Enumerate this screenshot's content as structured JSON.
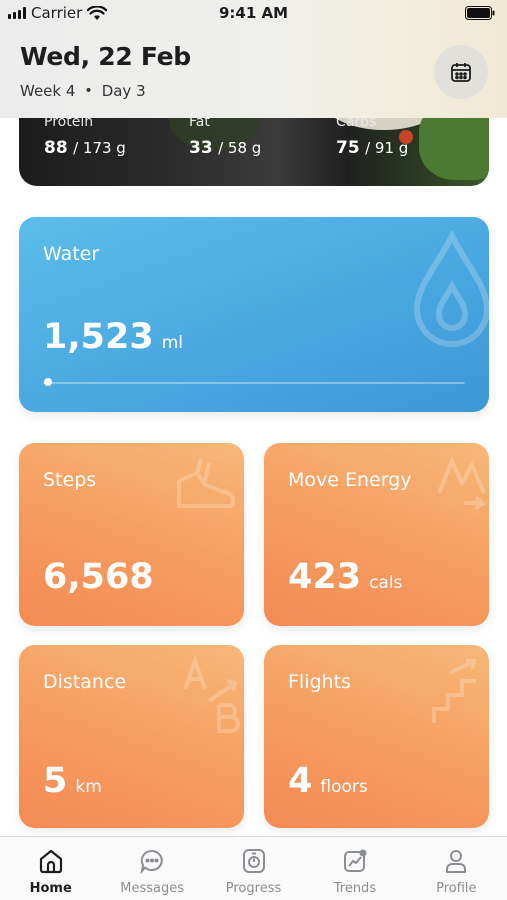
{
  "status_bar": {
    "carrier": "Carrier",
    "time": "9:41 AM"
  },
  "header": {
    "date": "Wed, 22 Feb",
    "week": "Week 4",
    "separator": "•",
    "day": "Day 3",
    "calendar_icon": "calendar-icon"
  },
  "nutrition": [
    {
      "label": "Protein",
      "value": "88",
      "goal": "/ 173 g"
    },
    {
      "label": "Fat",
      "value": "33",
      "goal": "/ 58 g"
    },
    {
      "label": "Carbs",
      "value": "75",
      "goal": "/ 91 g"
    }
  ],
  "water": {
    "title": "Water",
    "value": "1,523",
    "unit": "ml",
    "progress": 0.0,
    "icon": "water-drop-icon",
    "color": "#4aa8e0"
  },
  "steps": {
    "title": "Steps",
    "value": "6,568",
    "unit": "",
    "icon": "shoe-icon"
  },
  "move_energy": {
    "title": "Move Energy",
    "value": "423",
    "unit": "cals",
    "icon": "lightning-icon"
  },
  "distance": {
    "title": "Distance",
    "value": "5",
    "unit": "km",
    "icon": "a-to-b-icon"
  },
  "flights": {
    "title": "Flights",
    "value": "4",
    "unit": "floors",
    "icon": "stairs-icon"
  },
  "accent_orange": "#f59c5f",
  "tabs": [
    {
      "label": "Home",
      "icon": "home-icon",
      "active": true
    },
    {
      "label": "Messages",
      "icon": "chat-bubble-icon",
      "active": false
    },
    {
      "label": "Progress",
      "icon": "scale-icon",
      "active": false
    },
    {
      "label": "Trends",
      "icon": "trend-chart-icon",
      "active": false
    },
    {
      "label": "Profile",
      "icon": "user-icon",
      "active": false
    }
  ]
}
